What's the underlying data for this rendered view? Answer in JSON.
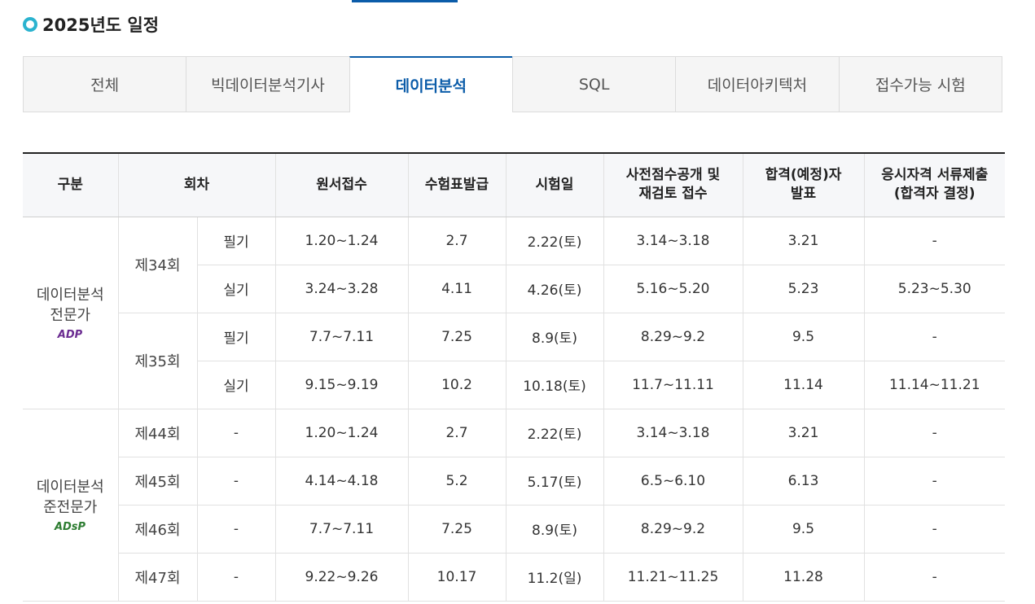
{
  "section": {
    "title": "2025년도 일정"
  },
  "tabs": [
    {
      "label": "전체",
      "active": false
    },
    {
      "label": "빅데이터분석기사",
      "active": false
    },
    {
      "label": "데이터분석",
      "active": true
    },
    {
      "label": "SQL",
      "active": false
    },
    {
      "label": "데이터아키텍처",
      "active": false
    },
    {
      "label": "접수가능 시험",
      "active": false
    }
  ],
  "table": {
    "headers": {
      "category": "구분",
      "round": "회차",
      "application": "원서접수",
      "admission": "수험표발급",
      "exam_date": "시험일",
      "prescore_line1": "사전점수공개 및",
      "prescore_line2": "재검토 접수",
      "result_line1": "합격(예정)자",
      "result_line2": "발표",
      "docs_line1": "응시자격 서류제출",
      "docs_line2": "(합격자 결정)"
    },
    "groups": [
      {
        "name_line1": "데이터분석",
        "name_line2": "전문가",
        "logo": "ADP",
        "logo_color": "#6b2c91",
        "rounds": [
          {
            "round": "제34회",
            "rows": [
              {
                "type": "필기",
                "application": "1.20~1.24",
                "admission": "2.7",
                "exam_date": "2.22(토)",
                "prescore": "3.14~3.18",
                "result": "3.21",
                "docs": "-"
              },
              {
                "type": "실기",
                "application": "3.24~3.28",
                "admission": "4.11",
                "exam_date": "4.26(토)",
                "prescore": "5.16~5.20",
                "result": "5.23",
                "docs": "5.23~5.30"
              }
            ]
          },
          {
            "round": "제35회",
            "rows": [
              {
                "type": "필기",
                "application": "7.7~7.11",
                "admission": "7.25",
                "exam_date": "8.9(토)",
                "prescore": "8.29~9.2",
                "result": "9.5",
                "docs": "-"
              },
              {
                "type": "실기",
                "application": "9.15~9.19",
                "admission": "10.2",
                "exam_date": "10.18(토)",
                "prescore": "11.7~11.11",
                "result": "11.14",
                "docs": "11.14~11.21"
              }
            ]
          }
        ]
      },
      {
        "name_line1": "데이터분석",
        "name_line2": "준전문가",
        "logo": "ADsP",
        "logo_color": "#2e7d32",
        "rows": [
          {
            "round": "제44회",
            "type": "-",
            "application": "1.20~1.24",
            "admission": "2.7",
            "exam_date": "2.22(토)",
            "prescore": "3.14~3.18",
            "result": "3.21",
            "docs": "-"
          },
          {
            "round": "제45회",
            "type": "-",
            "application": "4.14~4.18",
            "admission": "5.2",
            "exam_date": "5.17(토)",
            "prescore": "6.5~6.10",
            "result": "6.13",
            "docs": "-"
          },
          {
            "round": "제46회",
            "type": "-",
            "application": "7.7~7.11",
            "admission": "7.25",
            "exam_date": "8.9(토)",
            "prescore": "8.29~9.2",
            "result": "9.5",
            "docs": "-"
          },
          {
            "round": "제47회",
            "type": "-",
            "application": "9.22~9.26",
            "admission": "10.17",
            "exam_date": "11.2(일)",
            "prescore": "11.21~11.25",
            "result": "11.28",
            "docs": "-"
          }
        ]
      }
    ]
  }
}
